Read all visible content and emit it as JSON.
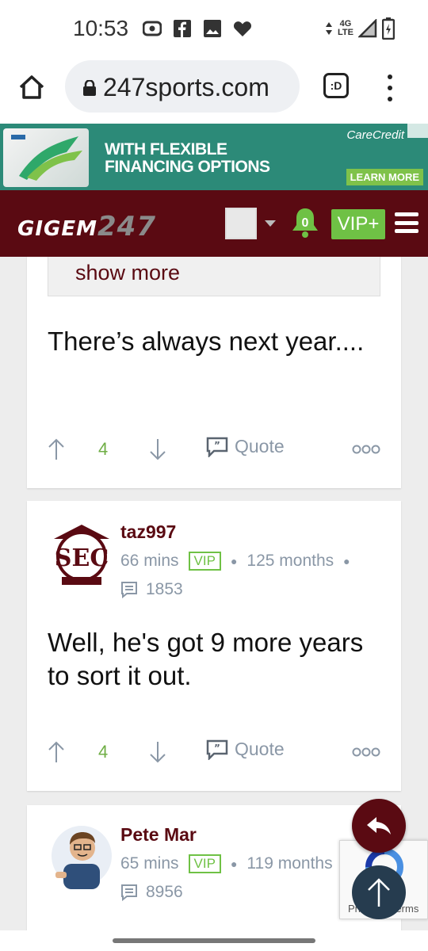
{
  "status_bar": {
    "time": "10:53",
    "network": "4G\nLTE",
    "icons": [
      "radio-icon",
      "facebook-icon",
      "image-icon",
      "heart-icon",
      "signal-icon",
      "battery-icon"
    ]
  },
  "browser": {
    "url": "247sports.com",
    "tabs_label": ":D"
  },
  "ad": {
    "headline_line1": "WITH FLEXIBLE",
    "headline_line2": "FINANCING OPTIONS",
    "brand": "CareCredit",
    "cta": "LEARN MORE"
  },
  "site_header": {
    "logo_text": "GIGEM",
    "logo_number": "247",
    "notification_count": "0",
    "vip_label": "VIP+"
  },
  "posts": [
    {
      "show_more": "show more",
      "text": "There’s always next year....",
      "votes": "4",
      "quote_label": "Quote"
    },
    {
      "author": "taz997",
      "time_ago": "66 mins",
      "badge": "VIP",
      "tenure": "125 months",
      "post_count": "1853",
      "text": "Well, he's got 9 more years to sort it out.",
      "votes": "4",
      "quote_label": "Quote"
    },
    {
      "author": "Pete Mar",
      "time_ago": "65 mins",
      "badge": "VIP",
      "tenure": "119 months",
      "post_count": "8956"
    }
  ],
  "recaptcha": {
    "text": "Privacy - Terms"
  },
  "colors": {
    "brand_maroon": "#5a0a12",
    "vip_green": "#6fc145",
    "meta_gray": "#8a97a6"
  }
}
